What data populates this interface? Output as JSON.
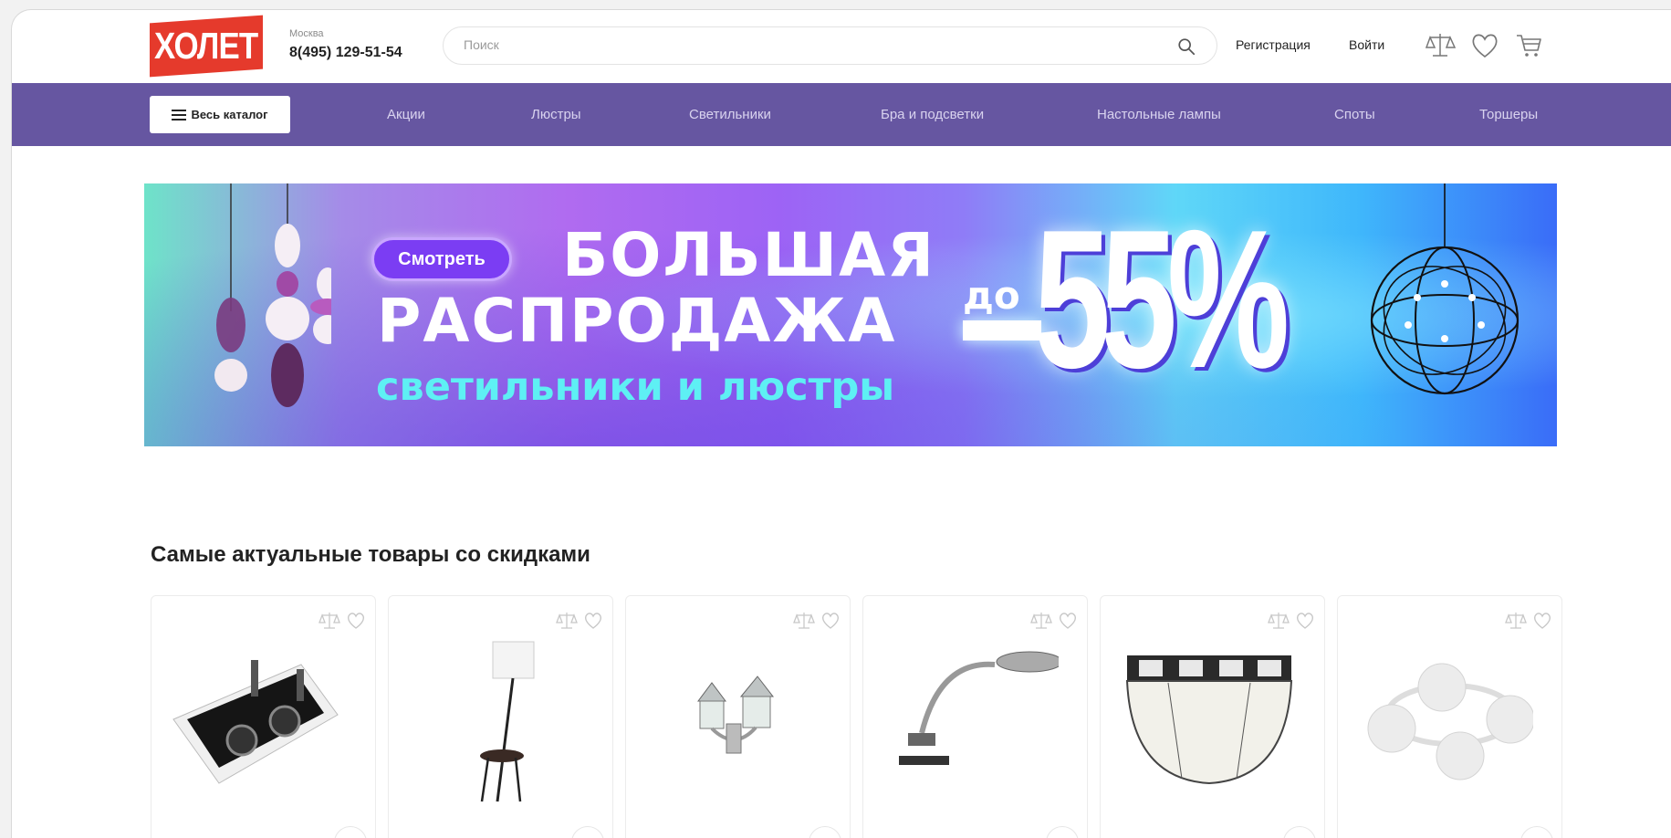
{
  "header": {
    "logo_text": "ХОЛЕТ",
    "city": "Москва",
    "phone": "8(495) 129-51-54",
    "search_placeholder": "Поиск",
    "register_label": "Регистрация",
    "login_label": "Войти",
    "icons": [
      "search-icon",
      "compare-icon",
      "heart-icon",
      "cart-icon"
    ]
  },
  "nav": {
    "catalog_label": "Весь каталог",
    "links": [
      "Акции",
      "Люстры",
      "Светильники",
      "Бра и подсветки",
      "Настольные лампы",
      "Споты",
      "Торшеры"
    ]
  },
  "banner": {
    "button_label": "Смотреть",
    "line1": "БОЛЬШАЯ",
    "line2": "РАСПРОДАЖА",
    "line3": "светильники и люстры",
    "prefix": "до",
    "discount": "55%"
  },
  "section": {
    "title": "Самые актуальные товары со скидками"
  },
  "products": [
    {
      "image": "recessed-spotlight-double"
    },
    {
      "image": "floor-lamp-with-table"
    },
    {
      "image": "outdoor-wall-lantern"
    },
    {
      "image": "clip-desk-lamp"
    },
    {
      "image": "wall-sconce-glass"
    },
    {
      "image": "ceiling-chandelier-glass-balls"
    }
  ],
  "colors": {
    "logo_red": "#e53a2c",
    "nav_purple": "#6656a1",
    "banner_button": "#7b3df3",
    "banner_subtitle": "#5ef0f4"
  }
}
